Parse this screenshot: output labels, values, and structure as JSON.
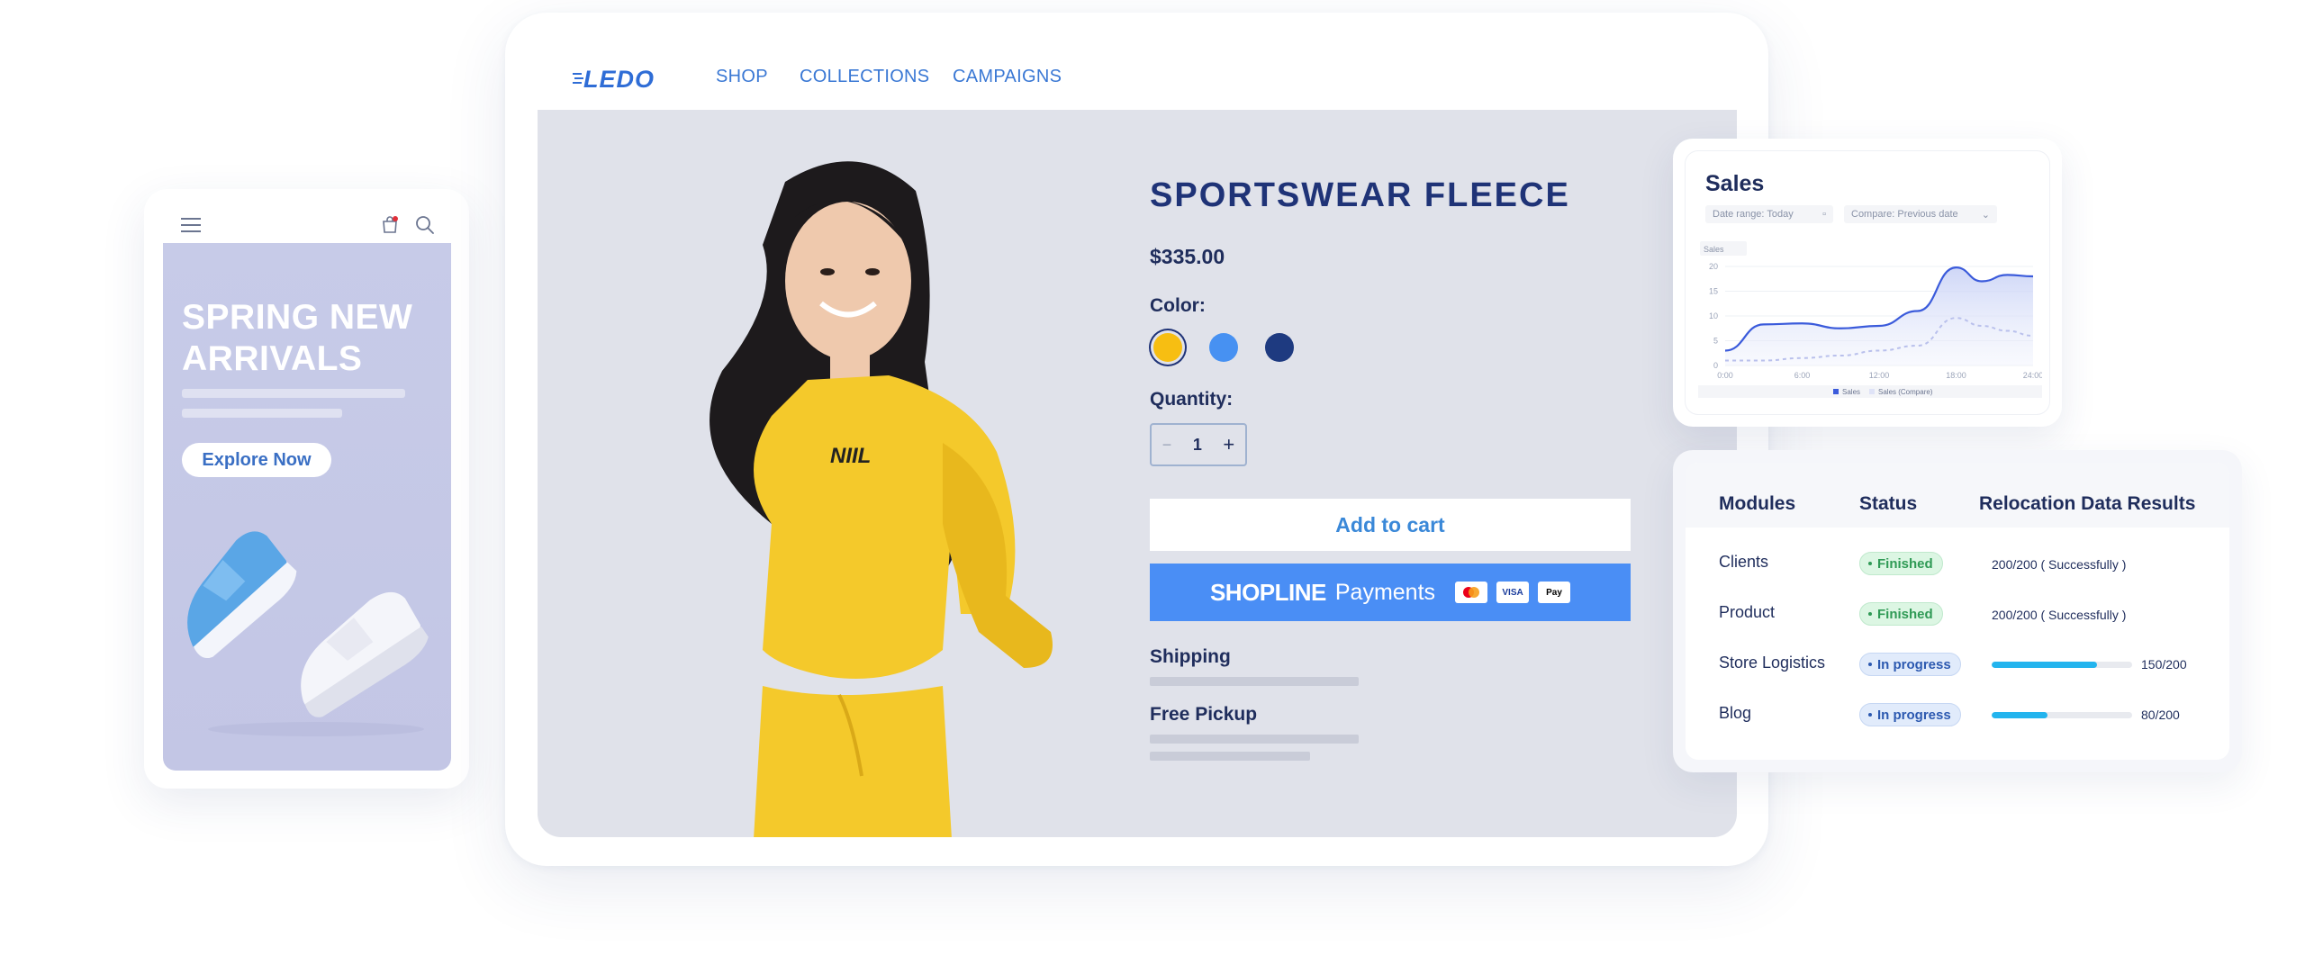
{
  "desktop": {
    "logo_text": "LEDO",
    "nav": [
      "SHOP",
      "COLLECTIONS",
      "CAMPAIGNS"
    ],
    "product": {
      "title": "SPORTSWEAR  FLEECE",
      "price": "$335.00",
      "color_label": "Color:",
      "colors": [
        "#f7be12",
        "#4791f2",
        "#1e3a80"
      ],
      "selected_color": "#f7be12",
      "quantity_label": "Quantity:",
      "quantity": "1",
      "minus": "−",
      "plus": "+",
      "add_to_cart": "Add to cart",
      "pay_brand": "SHOPLINE",
      "pay_brand_suffix": "Payments",
      "pay_methods": [
        "mastercard",
        "VISA",
        "Pay"
      ],
      "shipping_label": "Shipping",
      "pickup_label": "Free Pickup",
      "shirt_logo": "NIIL"
    }
  },
  "mobile": {
    "headline": "SPRING NEW ARRIVALS",
    "cta": "Explore Now",
    "icons": [
      "menu-icon",
      "shopping-bag-icon",
      "search-icon"
    ]
  },
  "sales": {
    "title": "Sales",
    "date_range": "Date range: Today",
    "compare": "Compare: Previous date",
    "metric_select": "Sales",
    "legend": [
      "Sales",
      "Sales (Compare)"
    ]
  },
  "chart_data": {
    "type": "area",
    "title": "Sales",
    "x": [
      "0:00",
      "6:00",
      "12:00",
      "18:00",
      "24:00"
    ],
    "ylim": [
      0,
      20
    ],
    "yticks": [
      0,
      5,
      10,
      15,
      20
    ],
    "series": [
      {
        "name": "Sales",
        "color": "#3b5bdb",
        "points": [
          [
            0,
            3
          ],
          [
            3,
            8.3
          ],
          [
            6,
            8.5
          ],
          [
            9,
            7.5
          ],
          [
            12,
            8
          ],
          [
            15,
            11
          ],
          [
            18,
            19.8
          ],
          [
            20,
            17
          ],
          [
            22,
            18.3
          ],
          [
            24,
            18
          ]
        ]
      },
      {
        "name": "Sales (Compare)",
        "color": "#b9c0ec",
        "points": [
          [
            0,
            1
          ],
          [
            3,
            1
          ],
          [
            6,
            1.5
          ],
          [
            9,
            2
          ],
          [
            12,
            3
          ],
          [
            15,
            4
          ],
          [
            18,
            9.6
          ],
          [
            20,
            8
          ],
          [
            22,
            7
          ],
          [
            24,
            6
          ]
        ]
      }
    ],
    "grid": true,
    "legend_position": "bottom"
  },
  "modules": {
    "headers": [
      "Modules",
      "Status",
      "Relocation Data Results"
    ],
    "rows": [
      {
        "name": "Clients",
        "status": "Finished",
        "result": "200/200  ( Successfully )"
      },
      {
        "name": "Product",
        "status": "Finished",
        "result": "200/200  ( Successfully )"
      },
      {
        "name": "Store Logistics",
        "status": "In progress",
        "progress": 0.75,
        "progress_text": "150/200"
      },
      {
        "name": "Blog",
        "status": "In progress",
        "progress": 0.4,
        "progress_text": "80/200"
      }
    ]
  }
}
